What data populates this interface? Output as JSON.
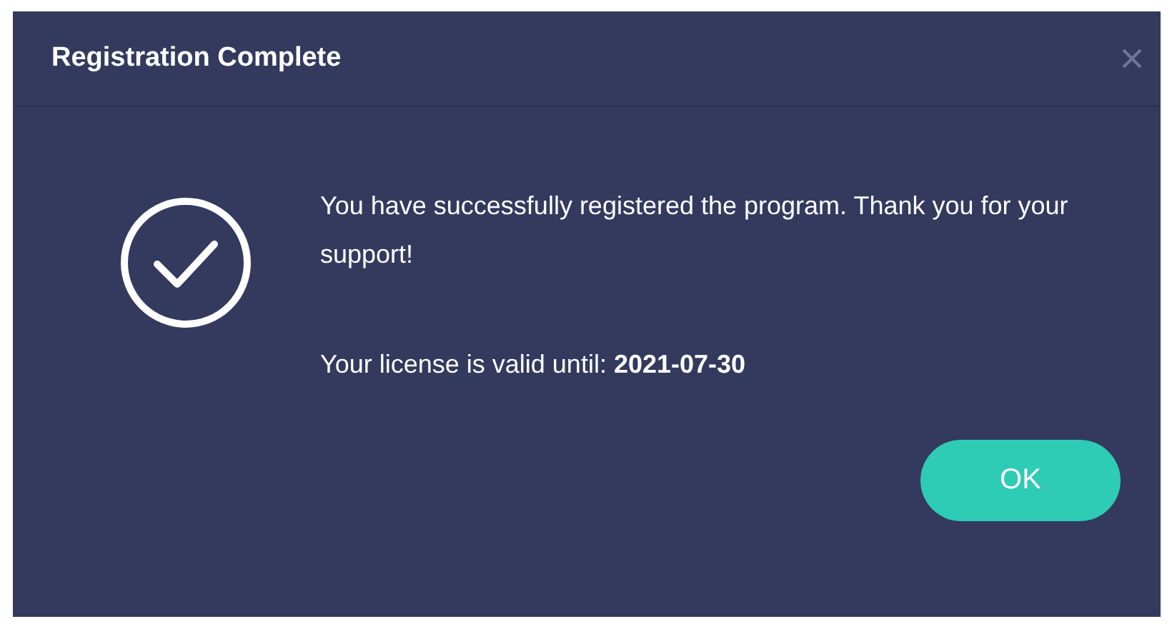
{
  "dialog": {
    "title": "Registration Complete",
    "message": "You have successfully registered the program. Thank you for your support!",
    "license": "Your license is valid until: **2021-07-30**",
    "button": "OK"
  }
}
